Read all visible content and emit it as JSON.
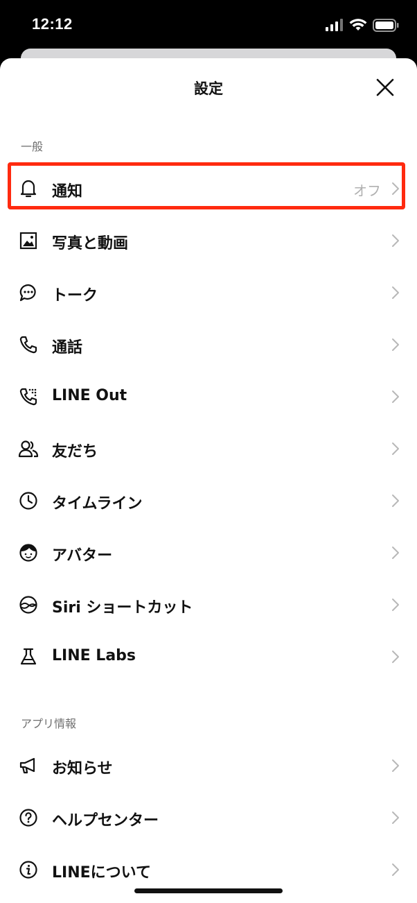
{
  "status_bar": {
    "time": "12:12",
    "signal_icon": "cellular-signal-icon",
    "wifi_icon": "wifi-icon",
    "battery_icon": "battery-icon"
  },
  "header": {
    "title": "設定",
    "close_icon": "close-icon"
  },
  "sections": [
    {
      "label": "一般",
      "items": [
        {
          "label": "通知",
          "icon": "bell-icon",
          "value": "オフ"
        },
        {
          "label": "写真と動画",
          "icon": "photo-icon"
        },
        {
          "label": "トーク",
          "icon": "chat-bubble-icon"
        },
        {
          "label": "通話",
          "icon": "phone-icon"
        },
        {
          "label": "LINE Out",
          "icon": "phone-dialpad-icon"
        },
        {
          "label": "友だち",
          "icon": "friends-icon"
        },
        {
          "label": "タイムライン",
          "icon": "clock-icon"
        },
        {
          "label": "アバター",
          "icon": "avatar-face-icon"
        },
        {
          "label": "Siri ショートカット",
          "icon": "siri-icon"
        },
        {
          "label": "LINE Labs",
          "icon": "flask-icon"
        }
      ]
    },
    {
      "label": "アプリ情報",
      "items": [
        {
          "label": "お知らせ",
          "icon": "megaphone-icon"
        },
        {
          "label": "ヘルプセンター",
          "icon": "help-icon"
        },
        {
          "label": "LINEについて",
          "icon": "info-icon"
        }
      ]
    }
  ],
  "colors": {
    "highlight": "#ff2a0f",
    "text": "#111111",
    "secondary": "#6f6f6f",
    "chevron": "#b8b8b8"
  }
}
